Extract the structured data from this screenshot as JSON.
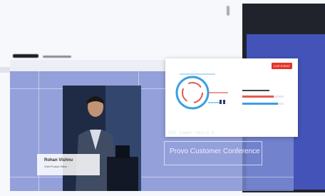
{
  "slide": {
    "badge": "LIVE EVENT"
  },
  "lower_third": {
    "label": "Cdt Lower third 1",
    "title": "Provo Customer Conference"
  },
  "name_card": {
    "name": "Rohan Vishnu",
    "role": "Chief Product Officer"
  },
  "colors": {
    "accent_blue": "#4453b8",
    "overlay": "#7d8cd2",
    "badge_red": "#e3352d"
  },
  "icons": [
    "speaker-video",
    "diagram-graphic"
  ]
}
